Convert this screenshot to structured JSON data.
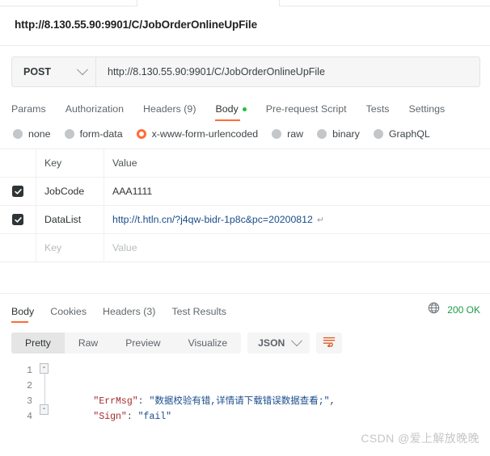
{
  "request": {
    "title": "http://8.130.55.90:9901/C/JobOrderOnlineUpFile",
    "method": "POST",
    "url": "http://8.130.55.90:9901/C/JobOrderOnlineUpFile",
    "tabs": [
      {
        "label": "Params",
        "active": false,
        "dot": false
      },
      {
        "label": "Authorization",
        "active": false,
        "dot": false
      },
      {
        "label": "Headers (9)",
        "active": false,
        "dot": false
      },
      {
        "label": "Body",
        "active": true,
        "dot": true
      },
      {
        "label": "Pre-request Script",
        "active": false,
        "dot": false
      },
      {
        "label": "Tests",
        "active": false,
        "dot": false
      },
      {
        "label": "Settings",
        "active": false,
        "dot": false
      }
    ],
    "body_types": [
      {
        "label": "none",
        "selected": false
      },
      {
        "label": "form-data",
        "selected": false
      },
      {
        "label": "x-www-form-urlencoded",
        "selected": true
      },
      {
        "label": "raw",
        "selected": false
      },
      {
        "label": "binary",
        "selected": false
      },
      {
        "label": "GraphQL",
        "selected": false
      }
    ],
    "table": {
      "headers": {
        "key": "Key",
        "value": "Value"
      },
      "rows": [
        {
          "checked": true,
          "key": "JobCode",
          "value": "AAA1111",
          "link": false,
          "newline": false
        },
        {
          "checked": true,
          "key": "DataList",
          "value": "http://t.htln.cn/?j4qw-bidr-1p8c&pc=20200812",
          "link": true,
          "newline": true
        }
      ],
      "empty_row": {
        "key_placeholder": "Key",
        "value_placeholder": "Value"
      },
      "return_symbol": "↵"
    }
  },
  "response": {
    "tabs": [
      {
        "label": "Body",
        "active": true
      },
      {
        "label": "Cookies",
        "active": false
      },
      {
        "label": "Headers (3)",
        "active": false
      },
      {
        "label": "Test Results",
        "active": false
      }
    ],
    "status": "200 OK",
    "status_color": "#1a9a4a",
    "globe_icon": "globe-icon",
    "views": [
      {
        "label": "Pretty",
        "active": true
      },
      {
        "label": "Raw",
        "active": false
      },
      {
        "label": "Preview",
        "active": false
      },
      {
        "label": "Visualize",
        "active": false
      }
    ],
    "format": "JSON",
    "wrap_icon": "word-wrap-icon",
    "code": {
      "line_numbers": [
        "1",
        "2",
        "3",
        "4"
      ],
      "lines": [
        {
          "fold": "-",
          "tokens": [
            {
              "t": "{",
              "c": "punc"
            }
          ]
        },
        {
          "fold": "",
          "tokens": [
            {
              "t": "    ",
              "c": "punc"
            },
            {
              "t": "\"ErrMsg\"",
              "c": "key"
            },
            {
              "t": ": ",
              "c": "punc"
            },
            {
              "t": "\"数据校验有错,详情请下载错误数据查看;\"",
              "c": "str"
            },
            {
              "t": ",",
              "c": "punc"
            }
          ]
        },
        {
          "fold": "",
          "tokens": [
            {
              "t": "    ",
              "c": "punc"
            },
            {
              "t": "\"Sign\"",
              "c": "key"
            },
            {
              "t": ": ",
              "c": "punc"
            },
            {
              "t": "\"fail\"",
              "c": "str"
            }
          ]
        },
        {
          "fold": "-",
          "tokens": [
            {
              "t": "}",
              "c": "punc"
            }
          ]
        }
      ]
    }
  },
  "watermark": "CSDN @爱上解放晚晚",
  "colors": {
    "accent": "#ff6c37",
    "success": "#1a9a4a",
    "checkbox": "#2f3437"
  }
}
